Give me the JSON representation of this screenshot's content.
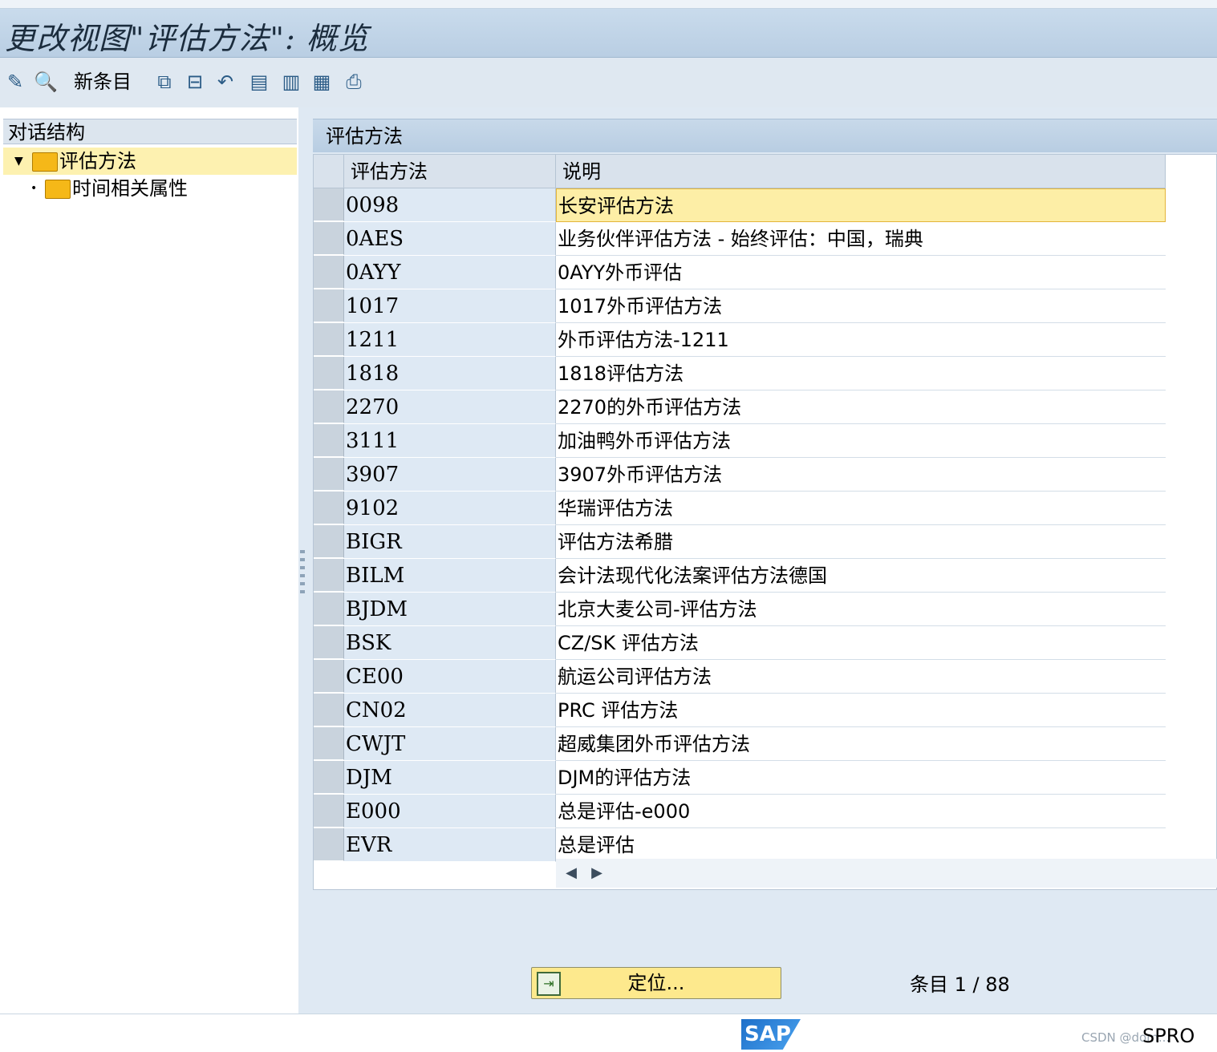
{
  "title": "更改视图\"评估方法\": 概览",
  "toolbar": {
    "new_entries_label": "新条目",
    "icons": [
      "display-change-icon",
      "details-icon",
      "copy-as-icon",
      "delete-icon",
      "undo-change-icon",
      "select-all-icon",
      "select-block-icon",
      "deselect-all-icon",
      "print-icon"
    ]
  },
  "dialog_structure": {
    "title": "对话结构",
    "items": [
      {
        "label": "评估方法",
        "selected": true,
        "expanded": true
      },
      {
        "label": "时间相关属性",
        "selected": false
      }
    ]
  },
  "table": {
    "title": "评估方法",
    "columns": [
      "评估方法",
      "说明"
    ],
    "rows": [
      {
        "code": "0098",
        "desc": "长安评估方法"
      },
      {
        "code": "0AES",
        "desc": "业务伙伴评估方法 - 始终评估：中国，瑞典"
      },
      {
        "code": "0AYY",
        "desc": "0AYY外币评估"
      },
      {
        "code": "1017",
        "desc": "1017外币评估方法"
      },
      {
        "code": "1211",
        "desc": "外币评估方法-1211"
      },
      {
        "code": "1818",
        "desc": "1818评估方法"
      },
      {
        "code": "2270",
        "desc": "2270的外币评估方法"
      },
      {
        "code": "3111",
        "desc": "加油鸭外币评估方法"
      },
      {
        "code": "3907",
        "desc": "3907外币评估方法"
      },
      {
        "code": "9102",
        "desc": "华瑞评估方法"
      },
      {
        "code": "BIGR",
        "desc": "评估方法希腊"
      },
      {
        "code": "BILM",
        "desc": "会计法现代化法案评估方法德国"
      },
      {
        "code": "BJDM",
        "desc": "北京大麦公司-评估方法"
      },
      {
        "code": "BSK",
        "desc": "CZ/SK 评估方法"
      },
      {
        "code": "CE00",
        "desc": "航运公司评估方法"
      },
      {
        "code": "CN02",
        "desc": "PRC 评估方法"
      },
      {
        "code": "CWJT",
        "desc": "超威集团外币评估方法"
      },
      {
        "code": "DJM",
        "desc": "DJM的评估方法"
      },
      {
        "code": "E000",
        "desc": "总是评估-e000"
      },
      {
        "code": "EVR",
        "desc": "总是评估"
      }
    ]
  },
  "position_button_label": "定位...",
  "entries": {
    "label": "条目",
    "current": "1",
    "total": "88",
    "text": "1 / 88"
  },
  "status": {
    "sap_logo": "SAP",
    "transaction": "SPRO",
    "watermark": "CSDN @dom..."
  }
}
